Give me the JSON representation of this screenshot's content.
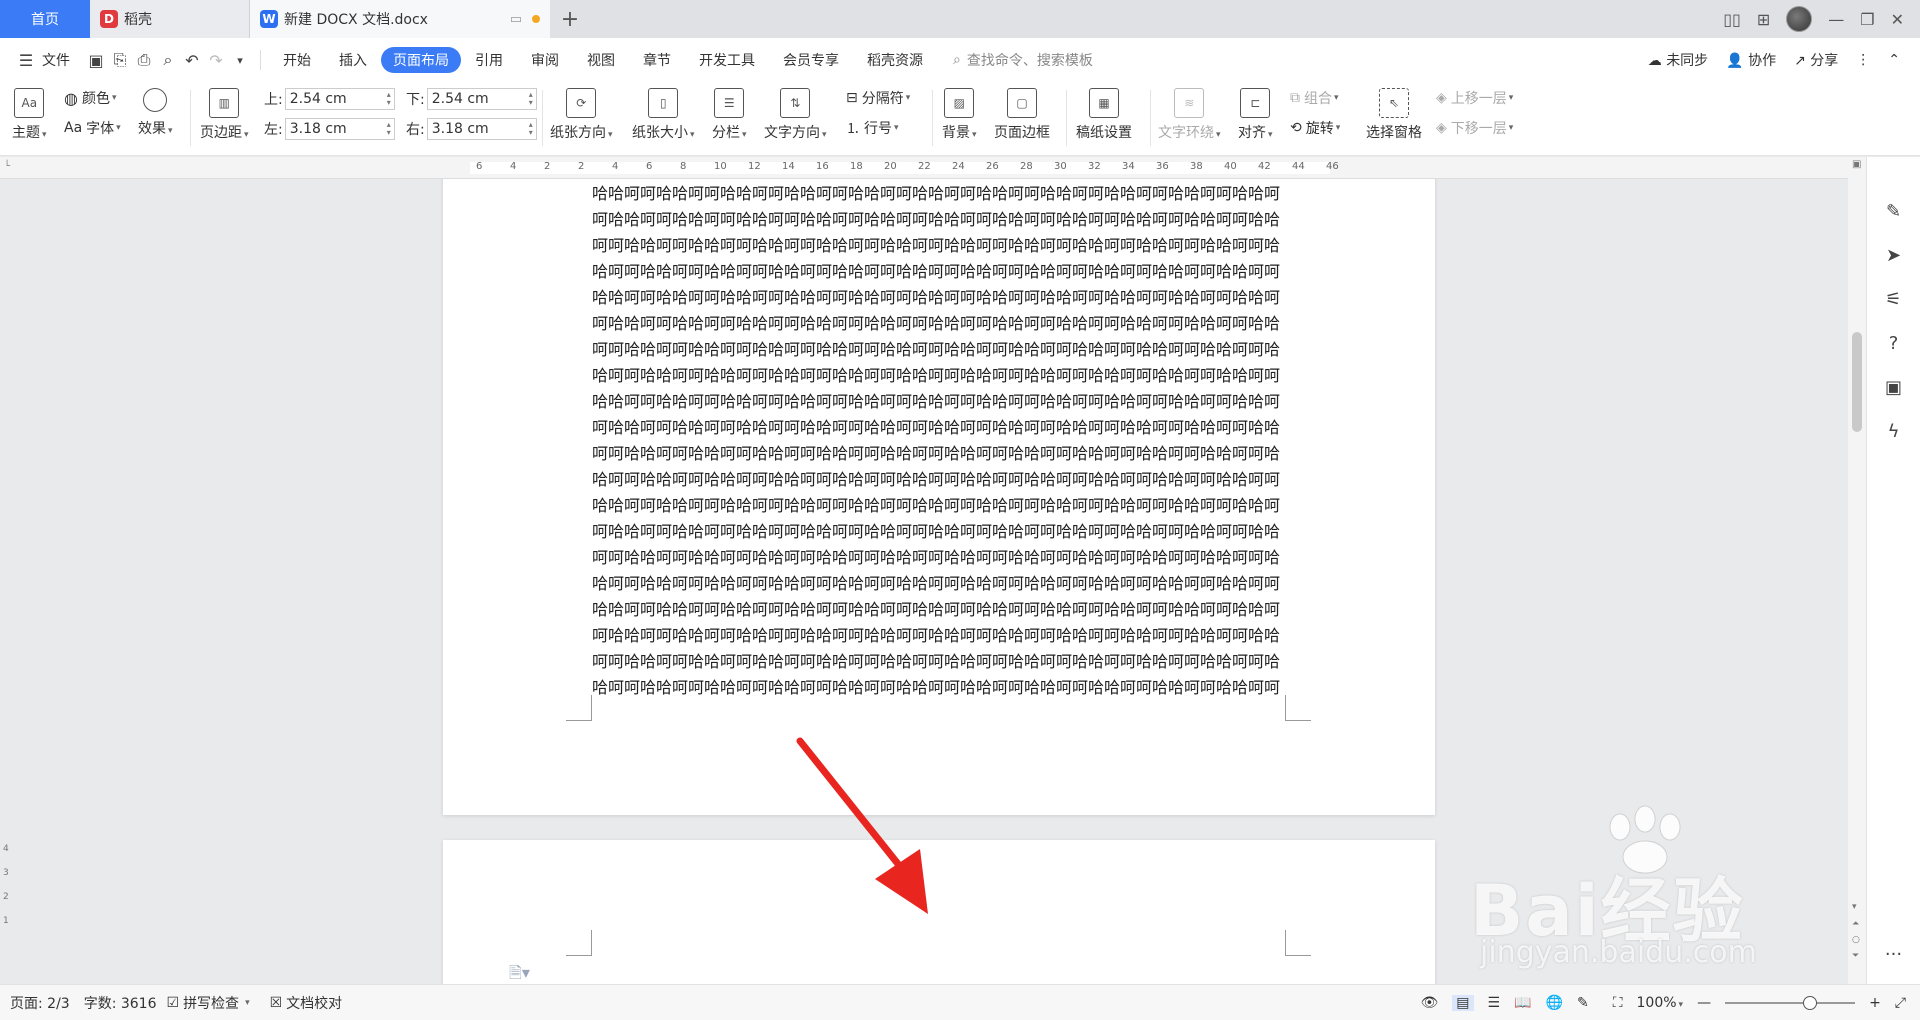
{
  "tabs": {
    "home": "首页",
    "daoke": "稻壳",
    "doc": "新建 DOCX 文档.docx",
    "new_tab": "+"
  },
  "menu": {
    "file": "文件",
    "items": [
      "开始",
      "插入",
      "页面布局",
      "引用",
      "审阅",
      "视图",
      "章节",
      "开发工具",
      "会员专享",
      "稻壳资源"
    ],
    "active": "页面布局",
    "search": "查找命令、搜索模板",
    "sync": "未同步",
    "collab": "协作",
    "share": "分享"
  },
  "ribbon": {
    "theme": "主题",
    "color": "颜色",
    "font": "字体",
    "effect": "效果",
    "margins": "页边距",
    "top_label": "上:",
    "top_value": "2.54 cm",
    "bottom_label": "下:",
    "bottom_value": "2.54 cm",
    "left_label": "左:",
    "left_value": "3.18 cm",
    "right_label": "右:",
    "right_value": "3.18 cm",
    "orientation": "纸张方向",
    "size": "纸张大小",
    "columns": "分栏",
    "text_dir": "文字方向",
    "breaks": "分隔符",
    "line_num": "行号",
    "background": "背景",
    "page_border": "页面边框",
    "manuscript": "稿纸设置",
    "wrap": "文字环绕",
    "align": "对齐",
    "rotate": "旋转",
    "group": "组合",
    "select_pane": "选择窗格",
    "bring_forward": "上移一层",
    "send_backward": "下移一层"
  },
  "ruler": {
    "ticks": [
      "6",
      "4",
      "2",
      "2",
      "4",
      "6",
      "8",
      "10",
      "12",
      "14",
      "16",
      "18",
      "20",
      "22",
      "24",
      "26",
      "28",
      "30",
      "32",
      "34",
      "36",
      "38",
      "40",
      "42",
      "44",
      "46"
    ]
  },
  "vruler": [
    "4",
    "3",
    "2",
    "1"
  ],
  "document": {
    "paragraph1": "哈哈呵呵哈哈呵呵哈哈呵呵哈哈呵呵哈哈呵呵哈哈呵呵哈哈呵呵哈哈呵呵哈哈呵呵哈哈呵呵哈哈呵呵哈哈呵呵哈哈呵呵哈哈呵呵哈哈呵呵哈哈呵呵哈哈呵呵哈哈呵呵哈哈呵呵哈哈呵呵哈哈呵呵哈哈呵呵哈哈呵呵哈哈呵呵哈哈呵呵哈哈呵呵哈哈呵呵哈哈呵呵哈哈呵呵哈哈呵呵哈哈呵呵哈哈呵呵哈哈呵呵哈哈呵呵哈哈呵呵哈哈呵呵哈哈呵呵哈哈呵呵哈哈呵呵哈哈呵呵哈哈呵呵哈哈呵呵哈哈呵呵哈哈呵呵哈哈呵呵哈哈呵呵哈哈呵呵哈哈呵呵哈哈呵呵哈哈呵呵哈哈呵呵哈哈呵呵哈哈呵呵哈哈呵呵哈哈呵呵哈哈呵呵哈哈呵呵哈哈呵呵哈哈呵呵哈哈呵呵哈哈呵呵哈哈呵呵哈哈呵呵哈哈呵呵哈哈呵呵哈哈呵呵哈哈呵呵哈哈呵呵哈哈呵呵哈哈呵呵哈哈呵呵哈哈呵呵哈哈呵呵哈哈呵呵哈哈呵呵哈哈呵呵哈哈呵呵哈哈呵呵哈哈呵呵哈哈呵呵哈哈呵呵哈哈呵呵哈哈呵呵哈哈呵呵哈哈呵呵哈哈呵呵哈哈呵呵哈哈呵呵哈哈呵呵哈哈呵呵哈哈呵呵哈哈呵呵哈哈呵呵哈哈呵呵哈哈呵呵哈哈呵呵哈哈呵呵哈哈呵呵哈哈呵呵哈哈呵呵哈哈呵呵哈哈呵呵哈哈呵呵哈哈呵呵哈哈呵呵哈哈呵呵哈哈呵呵哈哈",
    "paragraph2": "呵呵哈哈呵呵哈哈呵呵哈哈呵呵哈哈呵呵哈哈呵呵哈哈呵呵哈哈呵呵哈哈呵呵哈哈呵呵哈哈呵呵哈哈呵呵哈哈呵呵哈哈呵呵哈哈呵呵哈哈呵呵哈哈呵呵哈哈呵呵哈哈呵呵哈哈呵呵哈哈呵呵哈哈呵呵哈哈呵呵哈哈呵呵哈哈呵呵哈哈呵呵哈哈呵呵哈哈呵呵哈哈呵呵哈哈呵呵哈哈呵呵哈哈呵呵哈哈呵呵哈哈呵呵哈哈呵呵哈哈呵呵哈哈呵呵哈哈呵呵哈哈呵呵哈哈呵呵哈哈呵呵哈哈呵呵哈哈呵呵哈哈呵呵哈哈呵呵哈哈呵呵哈哈呵呵哈哈呵呵哈哈呵呵哈哈呵呵哈哈呵呵哈哈呵呵哈哈呵呵哈哈呵呵哈哈呵呵哈哈呵呵哈哈呵呵哈哈呵呵哈哈呵呵哈哈呵呵哈哈呵呵哈哈呵呵哈哈呵呵哈哈呵呵哈哈呵呵哈哈呵呵哈哈呵呵哈哈呵呵哈哈呵呵哈哈呵呵哈哈呵呵哈哈呵呵哈哈呵呵哈哈呵呵哈哈呵呵哈哈呵呵哈哈呵呵哈哈呵呵哈哈呵呵哈哈呵呵哈哈呵呵哈哈呵呵哈哈呵呵哈哈呵呵哈哈呵呵哈哈呵呵哈哈呵呵哈哈呵呵哈哈呵呵哈哈呵呵哈哈呵呵哈哈呵呵哈哈呵呵哈哈呵呵哈哈呵呵哈哈呵呵哈哈呵呵哈哈呵呵哈哈呵呵哈哈呵呵哈哈呵呵哈哈呵呵哈哈呵呵哈哈呵呵哈哈呵呵哈哈呵呵哈哈呵呵哈哈呵呵"
  },
  "watermark": {
    "brand": "Bai经验",
    "url": "jingyan.baidu.com"
  },
  "status": {
    "page": "页面: 2/3",
    "words": "字数: 3616",
    "spell": "拼写检查",
    "proof": "文档校对",
    "zoom": "100%"
  },
  "colors": {
    "accent": "#3b7cf6",
    "arrow": "#e8251f"
  }
}
